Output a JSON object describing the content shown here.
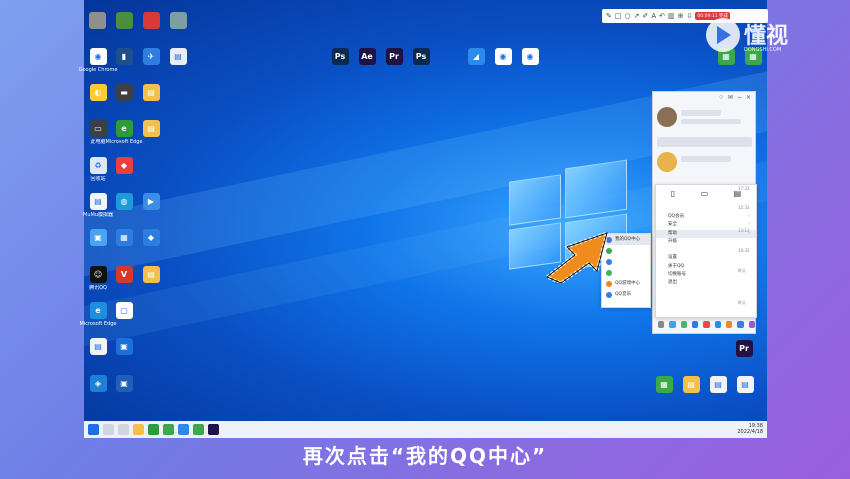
{
  "caption": "再次点击“我的QQ中心”",
  "toolbar": {
    "icons": [
      "pen-icon",
      "rect-icon",
      "circle-icon",
      "arrow-icon",
      "pencil-icon",
      "text-icon",
      "undo-icon",
      "delete-icon",
      "pin-icon",
      "download-icon"
    ],
    "button": "00:09:11 完成"
  },
  "logo": {
    "text": "懂视",
    "sub": "DONGSHI.COM"
  },
  "desktop": {
    "top_icons": [
      {
        "label": "",
        "color": "#8f8f8f"
      },
      {
        "label": "",
        "color": "#4b8e3b"
      },
      {
        "label": "",
        "color": "#d83a3a"
      },
      {
        "label": "",
        "color": "#7e9ea5"
      }
    ],
    "col1": [
      {
        "label": "Google Chrome",
        "color": "#ffffff",
        "glyph": "◉"
      },
      {
        "label": "",
        "color": "#ffcc33",
        "glyph": "◐"
      },
      {
        "label": "此电脑",
        "color": "#3c3f45",
        "glyph": "▭"
      },
      {
        "label": "回收站",
        "color": "#dfe8f2",
        "glyph": "♻"
      },
      {
        "label": "MuMu模拟器",
        "color": "#f5f5f5",
        "glyph": "▤"
      },
      {
        "label": "",
        "color": "#4aa3f0",
        "glyph": "▣"
      },
      {
        "label": "腾讯QQ",
        "color": "#111111",
        "glyph": "☺"
      },
      {
        "label": "Microsoft Edge",
        "color": "#1c8fdf",
        "glyph": "e"
      },
      {
        "label": "",
        "color": "#f3f3f3",
        "glyph": "▤"
      },
      {
        "label": "",
        "color": "#1e7fd9",
        "glyph": "◈"
      },
      {
        "label": "",
        "color": "#cfe7fb",
        "glyph": "◎"
      }
    ],
    "col2": [
      {
        "label": "",
        "color": "#1f4f8a",
        "glyph": "▮"
      },
      {
        "label": "",
        "color": "#3c3f45",
        "glyph": "▬"
      },
      {
        "label": "Microsoft Edge",
        "color": "#2f9a3a",
        "glyph": "e"
      },
      {
        "label": "",
        "color": "#e84040",
        "glyph": "◆"
      },
      {
        "label": "",
        "color": "#1e9ad6",
        "glyph": "◍"
      },
      {
        "label": "",
        "color": "#2d7de0",
        "glyph": "▦"
      },
      {
        "label": "",
        "color": "#d23b2a",
        "glyph": "V"
      },
      {
        "label": "",
        "color": "#ffffff",
        "glyph": "▢"
      },
      {
        "label": "",
        "color": "#1e6ed8",
        "glyph": "▣"
      },
      {
        "label": "",
        "color": "#1f5fb8",
        "glyph": "▣"
      }
    ],
    "col3": [
      {
        "label": "",
        "color": "#2e7de0",
        "glyph": "✈"
      },
      {
        "label": "",
        "color": "#f2c04b",
        "glyph": "▤"
      },
      {
        "label": "",
        "color": "#f2c04b",
        "glyph": "▤"
      },
      {
        "label": "",
        "color": "#3b8ee8",
        "glyph": "▶"
      },
      {
        "label": "",
        "color": "#2d7de0",
        "glyph": "◆"
      },
      {
        "label": "",
        "color": "#f2c04b",
        "glyph": "▤"
      },
      {
        "label": "",
        "color": "#33b44a",
        "glyph": "◌"
      }
    ],
    "col4": [
      {
        "label": "",
        "color": "#e9eef5",
        "glyph": "▤"
      }
    ],
    "adobe": [
      {
        "label": "",
        "color": "#0a2a52",
        "glyph": "Ps"
      },
      {
        "label": "",
        "color": "#1e1246",
        "glyph": "Ae"
      },
      {
        "label": "",
        "color": "#1e1246",
        "glyph": "Pr"
      },
      {
        "label": "",
        "color": "#0a2a52",
        "glyph": "Ps"
      }
    ],
    "mid": [
      {
        "label": "",
        "color": "#2c8be8",
        "glyph": "◢"
      },
      {
        "label": "",
        "color": "#ffffff",
        "glyph": "◉"
      },
      {
        "label": "",
        "color": "#ffffff",
        "glyph": "◉"
      }
    ],
    "right_top": [
      {
        "label": "",
        "color": "#3ba84a",
        "glyph": "▦"
      },
      {
        "label": "",
        "color": "#3ba84a",
        "glyph": "▦"
      }
    ],
    "right_pr": {
      "label": "",
      "color": "#1e1246",
      "glyph": "Pr"
    },
    "right_bottom": [
      {
        "label": "",
        "color": "#3ba84a",
        "glyph": "▦"
      },
      {
        "label": "",
        "color": "#f2c04b",
        "glyph": "▤"
      },
      {
        "label": "",
        "color": "#f3f3f3",
        "glyph": "▤"
      },
      {
        "label": "",
        "color": "#f3f3f3",
        "glyph": "▤"
      }
    ]
  },
  "qq_menu": {
    "top": [
      {
        "icon": "▯",
        "label": ""
      },
      {
        "icon": "▭",
        "label": ""
      },
      {
        "icon": "▤",
        "label": ""
      }
    ],
    "items": [
      {
        "label": "QQ会员",
        "chev": "›"
      },
      {
        "label": "安全",
        "chev": "›"
      },
      {
        "label": "帮助",
        "chev": "›"
      },
      {
        "label": "升级",
        "chev": ""
      },
      {
        "label": "",
        "chev": ""
      },
      {
        "label": "设置",
        "chev": ""
      },
      {
        "label": "关于QQ",
        "chev": ""
      },
      {
        "label": "切换账号",
        "chev": ""
      },
      {
        "label": "退出",
        "chev": ""
      }
    ]
  },
  "submenu": [
    {
      "label": "我的QQ中心",
      "color": "#4a74c9"
    },
    {
      "label": "",
      "color": "#3aaa4a"
    },
    {
      "label": "",
      "color": "#3b7be8"
    },
    {
      "label": "",
      "color": "#41b35a"
    },
    {
      "label": "QQ游戏中心",
      "color": "#e98a23"
    },
    {
      "label": "QQ音乐",
      "color": "#3b7be8"
    }
  ],
  "qq_times": [
    "17:31",
    "15:33",
    "13:11",
    "14:35",
    "昨天",
    "昨天"
  ],
  "tray": {
    "time": "19:38",
    "date": "2022/4/18"
  }
}
